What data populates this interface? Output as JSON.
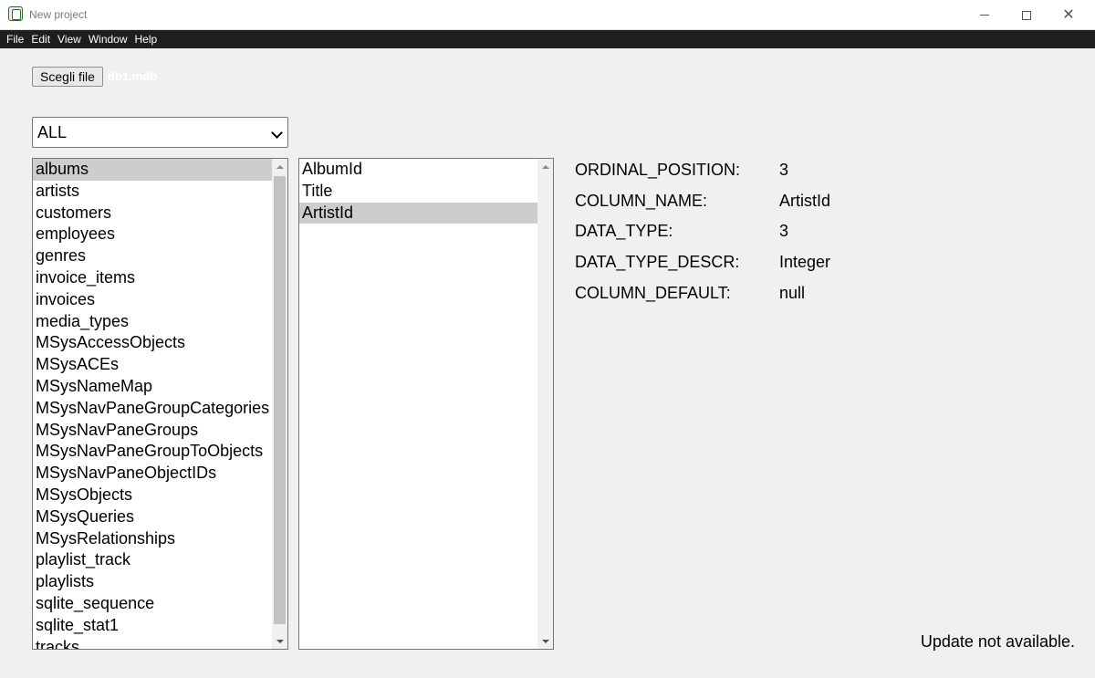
{
  "window": {
    "title": "New project",
    "icon": "app-database-icon",
    "controls": {
      "minimize_icon": "minimize-icon",
      "maximize_icon": "maximize-icon",
      "close_icon": "close-icon",
      "close_glyph": "✕"
    }
  },
  "menu": {
    "items": [
      "File",
      "Edit",
      "View",
      "Window",
      "Help"
    ]
  },
  "file_picker": {
    "button_label": "Scegli file",
    "file_name": "db1.mdb"
  },
  "filter_select": {
    "value": "ALL"
  },
  "tables_list": {
    "items": [
      "albums",
      "artists",
      "customers",
      "employees",
      "genres",
      "invoice_items",
      "invoices",
      "media_types",
      "MSysAccessObjects",
      "MSysACEs",
      "MSysNameMap",
      "MSysNavPaneGroupCategories",
      "MSysNavPaneGroups",
      "MSysNavPaneGroupToObjects",
      "MSysNavPaneObjectIDs",
      "MSysObjects",
      "MSysQueries",
      "MSysRelationships",
      "playlist_track",
      "playlists",
      "sqlite_sequence",
      "sqlite_stat1",
      "tracks"
    ],
    "selected": "albums"
  },
  "columns_list": {
    "items": [
      "AlbumId",
      "Title",
      "ArtistId"
    ],
    "selected": "ArtistId"
  },
  "column_properties": [
    {
      "key": "ORDINAL_POSITION:",
      "value": "3"
    },
    {
      "key": "COLUMN_NAME:",
      "value": "ArtistId"
    },
    {
      "key": "DATA_TYPE:",
      "value": "3"
    },
    {
      "key": "DATA_TYPE_DESCR:",
      "value": "Integer"
    },
    {
      "key": "COLUMN_DEFAULT:",
      "value": "null"
    }
  ],
  "status": {
    "text": "Update not available."
  },
  "colors": {
    "menubar_bg": "#1e1e1e",
    "selection_bg": "#cdcdcd",
    "window_bg": "#f0f0f0"
  }
}
